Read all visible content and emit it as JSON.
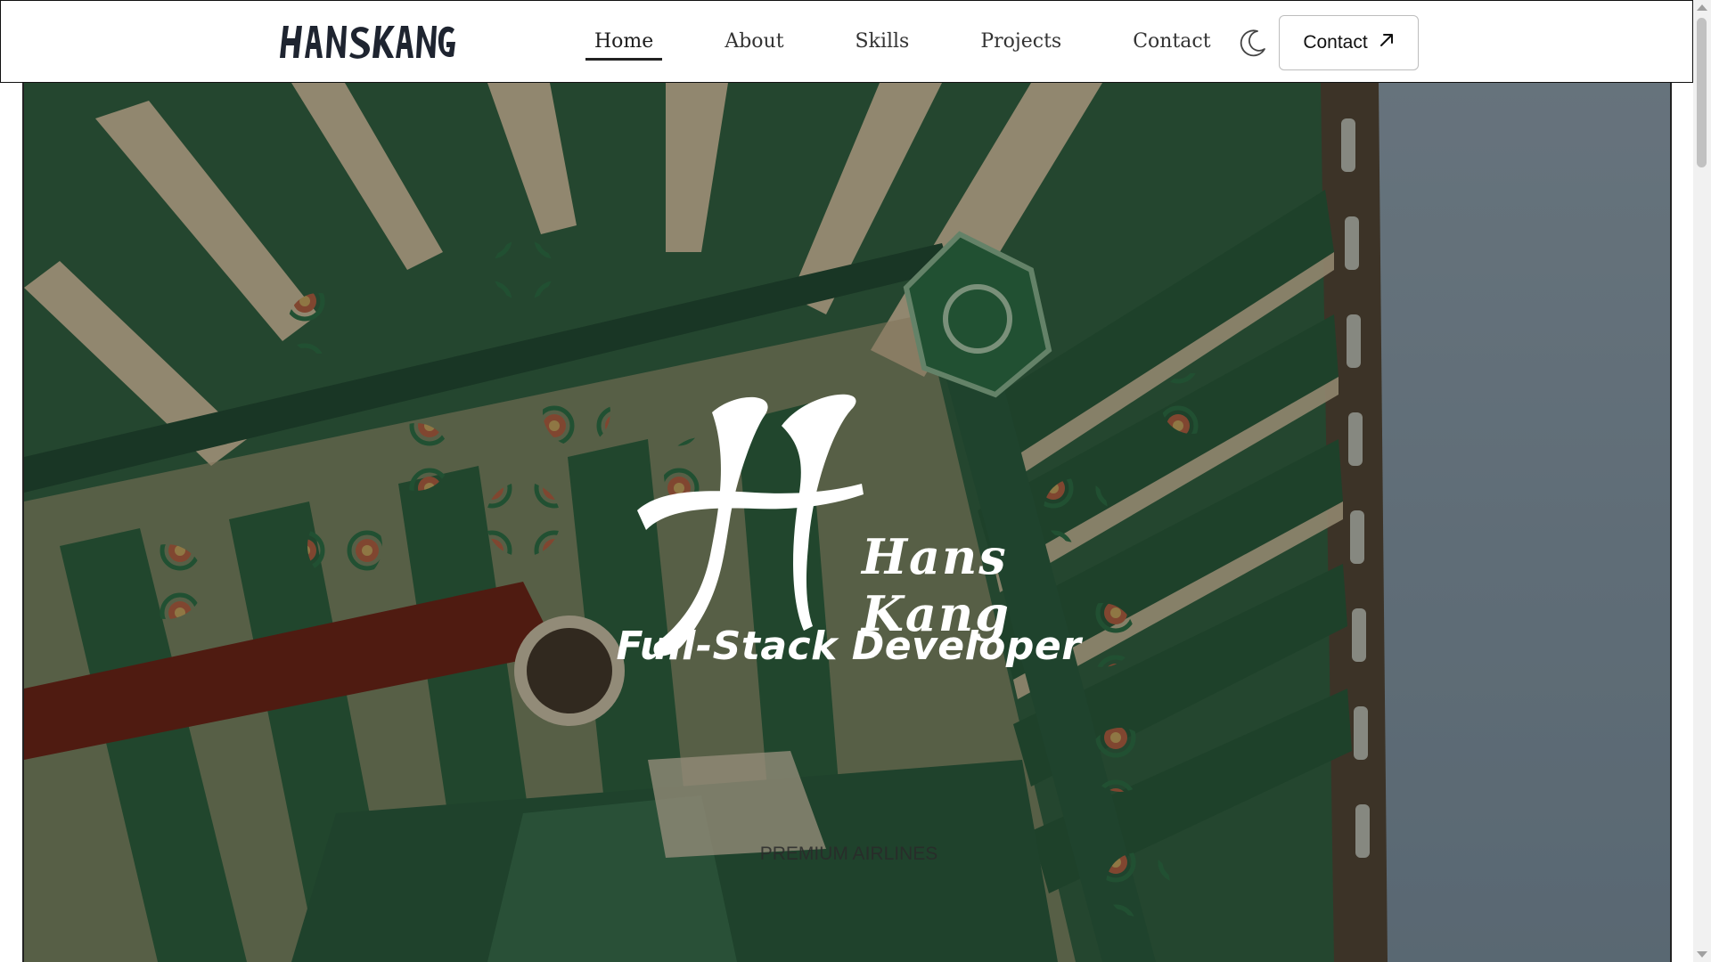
{
  "header": {
    "logo_text": "HANSKANG",
    "nav": [
      {
        "label": "Home",
        "active": true
      },
      {
        "label": "About",
        "active": false
      },
      {
        "label": "Skills",
        "active": false
      },
      {
        "label": "Projects",
        "active": false
      },
      {
        "label": "Contact",
        "active": false
      }
    ],
    "theme_icon": "moon-icon",
    "contact_button": {
      "label": "Contact",
      "icon": "arrow-up-right-icon"
    }
  },
  "hero": {
    "title": "Hans Kang",
    "subtitle": "Full-Stack Developer",
    "tagline": "PREMIUM AIRLINES"
  },
  "colors": {
    "dancheong_green": "#2f6a45",
    "dancheong_red": "#8a2a1f",
    "wood_cream": "#e8d7b6",
    "sky": "#93a9bd"
  }
}
